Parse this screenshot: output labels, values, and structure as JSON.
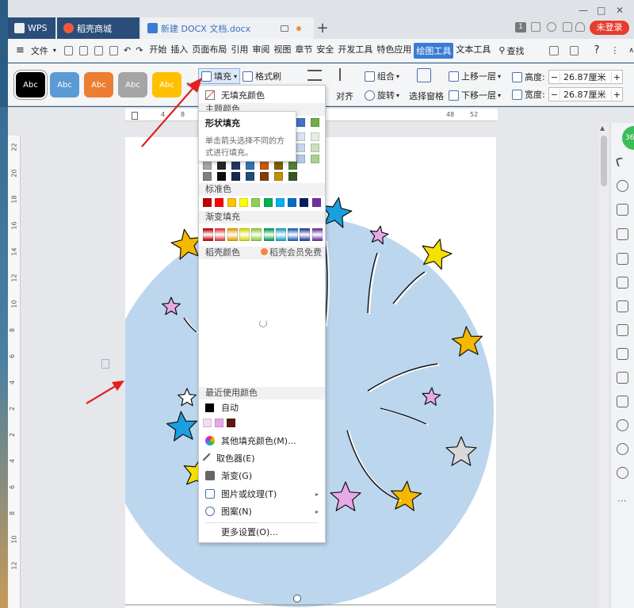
{
  "titlebar": {
    "tabs": [
      {
        "label": "WPS"
      },
      {
        "label": "稻壳商城"
      },
      {
        "label": "新建 DOCX 文档.docx"
      }
    ],
    "add_tab": "+",
    "page_badge": "1",
    "login": "未登录",
    "window_controls": {
      "minimize": "—",
      "maximize": "□",
      "close": "✕"
    }
  },
  "menubar": {
    "file": "文件",
    "items": [
      "开始",
      "插入",
      "页面布局",
      "引用",
      "审阅",
      "视图",
      "章节",
      "安全",
      "开发工具",
      "特色应用",
      "绘图工具",
      "文本工具"
    ],
    "active": "绘图工具",
    "search": "查找",
    "help": "?"
  },
  "ribbon": {
    "styles": [
      {
        "label": "Abc",
        "color": "#000000"
      },
      {
        "label": "Abc",
        "color": "#5b9bd5"
      },
      {
        "label": "Abc",
        "color": "#ed7d31"
      },
      {
        "label": "Abc",
        "color": "#a5a5a5"
      },
      {
        "label": "Abc",
        "color": "#ffc000"
      }
    ],
    "fill": "填充",
    "format_painter": "格式刷",
    "align": "对齐",
    "group": "组合",
    "rotate": "旋转",
    "select_pane": "选择窗格",
    "bring_forward": "上移一层",
    "send_backward": "下移一层",
    "height_label": "高度:",
    "height_value": "26.87厘米",
    "width_label": "宽度:",
    "width_value": "26.87厘米"
  },
  "ruler": {
    "top": [
      "4",
      "8",
      "48",
      "52"
    ],
    "left": [
      "22",
      "20",
      "18",
      "16",
      "14",
      "12",
      "10",
      "8",
      "6",
      "4",
      "2",
      "2",
      "4",
      "6",
      "8",
      "10",
      "12"
    ]
  },
  "fill_menu": {
    "no_fill": "无填充颜色",
    "theme_colors": "主题颜色",
    "standard_colors": "标准色",
    "gradient_fill": "渐变填充",
    "docer_colors": "稻壳颜色",
    "docer_member": "稻壳会员免费",
    "recent_colors": "最近使用颜色",
    "auto": "自动",
    "more_colors": "其他填充颜色(M)...",
    "eyedropper": "取色器(E)",
    "gradient": "渐变(G)",
    "picture_texture": "图片或纹理(T)",
    "pattern": "图案(N)",
    "more_settings": "更多设置(O)..."
  },
  "tooltip": {
    "title": "形状填充",
    "description": "单击箭头选择不同的方式进行填充。"
  },
  "side_badge": "36",
  "colors": {
    "accent": "#3a7bd5",
    "circle_fill": "#bcd6ee",
    "annotation_arrow": "#e02020",
    "standard": [
      "#c00000",
      "#ff0000",
      "#ffc000",
      "#ffff00",
      "#92d050",
      "#00b050",
      "#00b0f0",
      "#0070c0",
      "#002060",
      "#7030a0"
    ],
    "gradient": [
      "#c00000",
      "#e03b3b",
      "#e8a000",
      "#d8d800",
      "#8fc93a",
      "#00a050",
      "#1aa3c9",
      "#1b63b8",
      "#253d9a",
      "#6b2fa0"
    ],
    "theme_row_partial": [
      "#4472c4",
      "#70ad47"
    ],
    "theme_grid": [
      [
        "#a5a5a5",
        "#262626",
        "#1f3864",
        "#2e75b6",
        "#c55a11",
        "#7f6000",
        "#548235"
      ],
      [
        "#7f7f7f",
        "#0d0d0d",
        "#172b4d",
        "#1f4e79",
        "#843c0c",
        "#bf9000",
        "#375623"
      ]
    ],
    "recent": [
      "#000000",
      "#f2dcf5",
      "#e6a7e8",
      "#5c1a0a"
    ]
  },
  "stars": [
    {
      "color": "#f5b800"
    },
    {
      "color": "#1aa0e0"
    },
    {
      "color": "#e8a8e8"
    },
    {
      "color": "#f5e000"
    },
    {
      "color": "#f5b800"
    },
    {
      "color": "#e8a8e8"
    },
    {
      "color": "#e8a8e8"
    },
    {
      "color": "#ffffff"
    },
    {
      "color": "#d8d8d8"
    },
    {
      "color": "#1aa0e0"
    },
    {
      "color": "#f5e000"
    },
    {
      "color": "#f5b800"
    },
    {
      "color": "#e8a8e8"
    }
  ]
}
